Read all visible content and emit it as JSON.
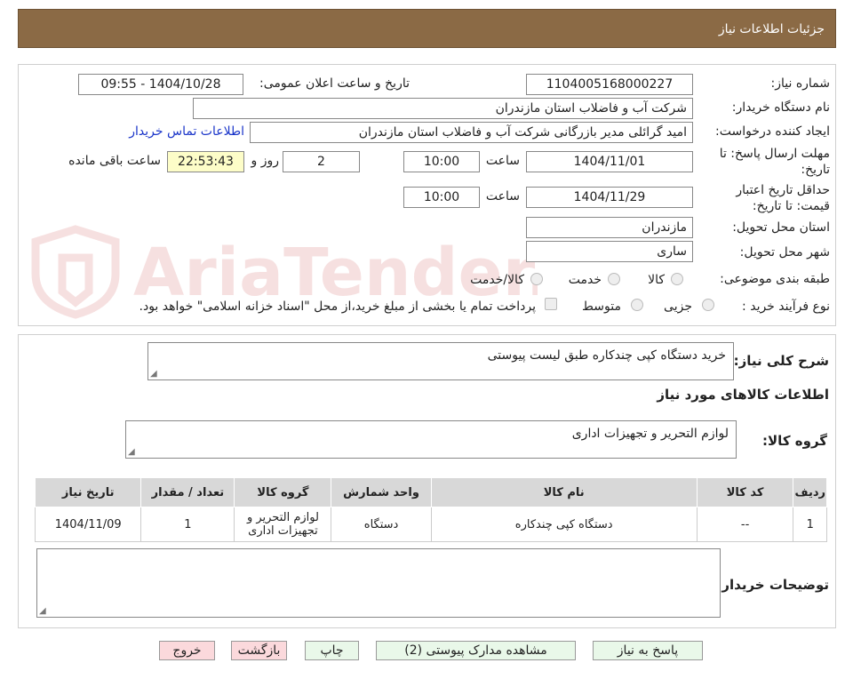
{
  "header": {
    "title": "جزئیات اطلاعات نیاز"
  },
  "watermark": "AriaTender.neT",
  "form": {
    "need_number_label": "شماره نیاز:",
    "need_number": "1104005168000227",
    "announce_label": "تاریخ و ساعت اعلان عمومی:",
    "announce_value": "1404/10/28 - 09:55",
    "buyer_org_label": "نام دستگاه خریدار:",
    "buyer_org": "شرکت آب و فاضلاب استان مازندران",
    "creator_label": "ایجاد کننده درخواست:",
    "creator": "امید گرائلی مدیر بازرگانی شرکت آب و فاضلاب استان مازندران",
    "contact_link": "اطلاعات تماس خریدار",
    "deadline_label_1": "مهلت ارسال پاسخ: تا",
    "deadline_label_2": "تاریخ:",
    "deadline_date": "1404/11/01",
    "time_label": "ساعت",
    "deadline_time": "10:00",
    "days_value": "2",
    "days_label": "روز و",
    "remaining_time": "22:53:43",
    "remaining_label": "ساعت باقی مانده",
    "validity_label_1": "حداقل تاریخ اعتبار",
    "validity_label_2": "قیمت: تا تاریخ:",
    "validity_date": "1404/11/29",
    "validity_time": "10:00",
    "province_label": "استان محل تحویل:",
    "province": "مازندران",
    "city_label": "شهر محل تحویل:",
    "city": "ساری",
    "category_label": "طبقه بندی موضوعی:",
    "category_options": [
      "کالا",
      "خدمت",
      "کالا/خدمت"
    ],
    "process_label": "نوع فرآیند خرید :",
    "process_options": [
      "جزیی",
      "متوسط"
    ],
    "payment_note": "پرداخت تمام یا بخشی از مبلغ خرید،از محل \"اسناد خزانه اسلامی\" خواهد بود."
  },
  "description": {
    "label": "شرح کلی نیاز:",
    "value": "خرید دستگاه کپی چندکاره طبق لیست پیوستی",
    "goods_info_title": "اطلاعات کالاهای مورد نیاز",
    "group_label": "گروه کالا:",
    "group_value": "لوازم التحریر و تجهیزات اداری"
  },
  "table": {
    "headers": [
      "ردیف",
      "کد کالا",
      "نام کالا",
      "واحد شمارش",
      "گروه کالا",
      "تعداد / مقدار",
      "تاریخ نیاز"
    ],
    "rows": [
      [
        "1",
        "--",
        "دستگاه کپی چندکاره",
        "دستگاه",
        "لوازم التحریر و تجهیزات اداری",
        "1",
        "1404/11/09"
      ]
    ]
  },
  "buyer_notes": {
    "label": "توضیحات خریدار:"
  },
  "buttons": {
    "reply": "پاسخ به نیاز",
    "attachments": "مشاهده مدارک پیوستی (2)",
    "print": "چاپ",
    "back": "بازگشت",
    "exit": "خروج"
  },
  "colors": {
    "header_bg": "#8b6a45",
    "link": "#1a35c9",
    "remaining_bg": "#fdfdc8",
    "button_green": "#e9f8e9",
    "button_pink": "#fbd9dc"
  }
}
